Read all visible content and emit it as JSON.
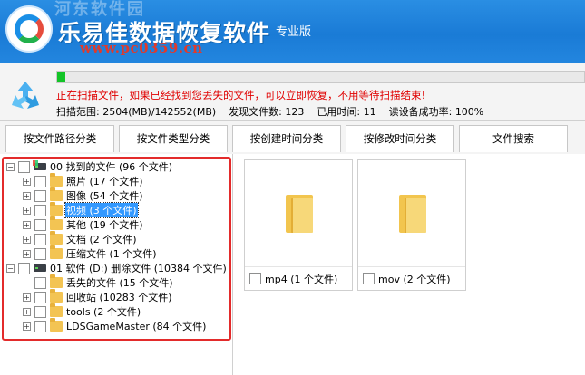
{
  "app": {
    "title": "乐易佳数据恢复软件",
    "edition": "专业版",
    "watermark": "河东软件园",
    "site": "www.pc0359.cn"
  },
  "status": {
    "progress": 0.016,
    "message": "正在扫描文件，如果已经找到您丢失的文件，可以立即恢复，不用等待扫描结束!",
    "scan_range_label": "扫描范围:",
    "scan_range_value": "2504(MB)/142552(MB)",
    "files_found_label": "发现文件数:",
    "files_found_value": "123",
    "elapsed_label": "已用时间:",
    "elapsed_value": "11",
    "read_rate_label": "读设备成功率:",
    "read_rate_value": "100%"
  },
  "tabs": [
    {
      "label": "按文件路径分类"
    },
    {
      "label": "按文件类型分类"
    },
    {
      "label": "按创建时间分类"
    },
    {
      "label": "按修改时间分类"
    },
    {
      "label": "文件搜索"
    }
  ],
  "tree": {
    "groups": [
      {
        "label": "00 找到的文件  (96 个文件)",
        "children": [
          {
            "label": "照片    (17 个文件)"
          },
          {
            "label": "图像    (54 个文件)"
          },
          {
            "label": "视频    (3 个文件)"
          },
          {
            "label": "其他    (19 个文件)"
          },
          {
            "label": "文档    (2 个文件)"
          },
          {
            "label": "压缩文件    (1 个文件)"
          }
        ]
      },
      {
        "label": "01 软件 (D:) 删除文件 (10384 个文件)",
        "children": [
          {
            "label": "丢失的文件    (15 个文件)"
          },
          {
            "label": "回收站    (10283 个文件)"
          },
          {
            "label": "tools    (2 个文件)"
          },
          {
            "label": "LDSGameMaster    (84 个文件)"
          }
        ]
      }
    ]
  },
  "results": [
    {
      "label": "mp4 (1 个文件)"
    },
    {
      "label": "mov (2 个文件)"
    }
  ],
  "colors": {
    "titlebar": "#1a7bd6",
    "message": "#e00000",
    "progress": "#13c427",
    "highlight_frame": "#e32b2b",
    "selection": "#3399ff"
  }
}
